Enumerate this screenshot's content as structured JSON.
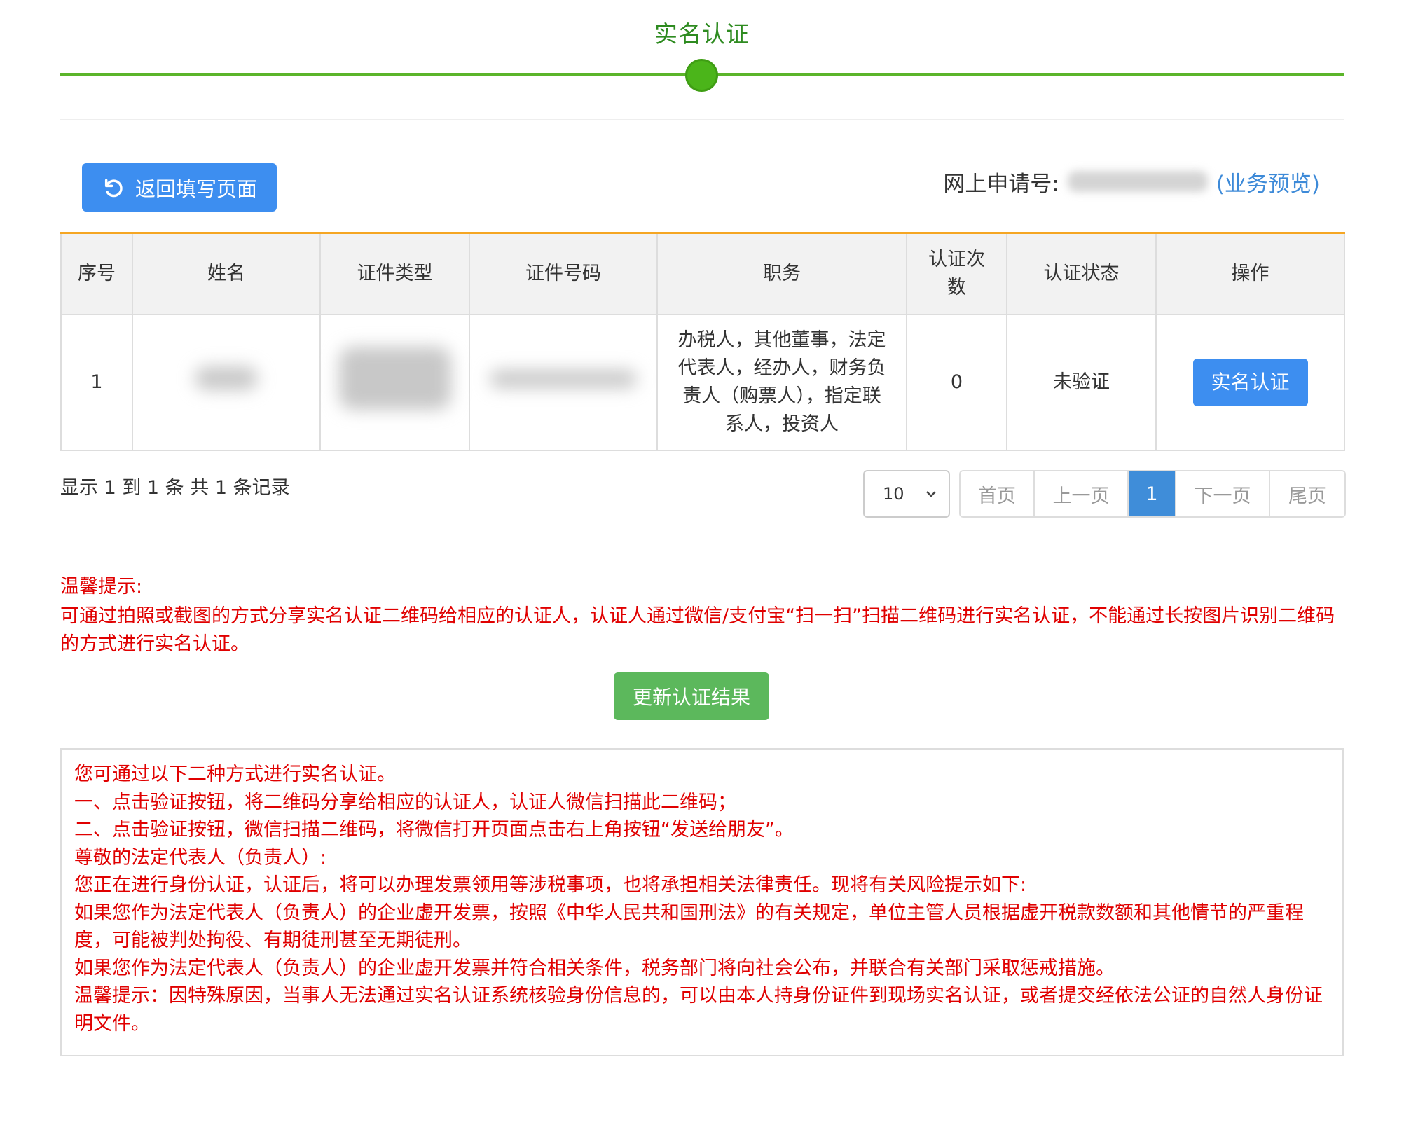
{
  "step": {
    "title": "实名认证"
  },
  "toolbar": {
    "back_label": "返回填写页面"
  },
  "application": {
    "label": "网上申请号:",
    "preview_link": "(业务预览)"
  },
  "table": {
    "headers": [
      "序号",
      "姓名",
      "证件类型",
      "证件号码",
      "职务",
      "认证次数",
      "认证状态",
      "操作"
    ],
    "rows": [
      {
        "index": "1",
        "role": "办税人，其他董事，法定代表人，经办人，财务负责人（购票人），指定联系人，投资人",
        "count": "0",
        "status": "未验证",
        "action": "实名认证"
      }
    ]
  },
  "pagination": {
    "summary": "显示 1 到 1 条 共 1 条记录",
    "page_size": "10",
    "first": "首页",
    "prev": "上一页",
    "current": "1",
    "next": "下一页",
    "last": "尾页"
  },
  "tip": {
    "title": "温馨提示:",
    "body": "可通过拍照或截图的方式分享实名认证二维码给相应的认证人，认证人通过微信/支付宝“扫一扫”扫描二维码进行实名认证，不能通过长按图片识别二维码的方式进行实名认证。"
  },
  "update_button": "更新认证结果",
  "notice": {
    "lines": [
      "您可通过以下二种方式进行实名认证。",
      "一、点击验证按钮，将二维码分享给相应的认证人，认证人微信扫描此二维码；",
      "二、点击验证按钮，微信扫描二维码，将微信打开页面点击右上角按钮“发送给朋友”。",
      "尊敬的法定代表人（负责人）:",
      "您正在进行身份认证，认证后，将可以办理发票领用等涉税事项，也将承担相关法律责任。现将有关风险提示如下:",
      "如果您作为法定代表人（负责人）的企业虚开发票，按照《中华人民共和国刑法》的有关规定，单位主管人员根据虚开税款数额和其他情节的严重程度，可能被判处拘役、有期徒刑甚至无期徒刑。",
      "如果您作为法定代表人（负责人）的企业虚开发票并符合相关条件，税务部门将向社会公布，并联合有关部门采取惩戒措施。",
      "温馨提示：因特殊原因，当事人无法通过实名认证系统核验身份信息的，可以由本人持身份证件到现场实名认证，或者提交经依法公证的自然人身份证明文件。"
    ]
  },
  "colors": {
    "primary": "#3d8ef0",
    "success": "#5cb85c",
    "warning": "#e00000",
    "step": "#4bb51a",
    "table_accent": "#f5a623"
  }
}
